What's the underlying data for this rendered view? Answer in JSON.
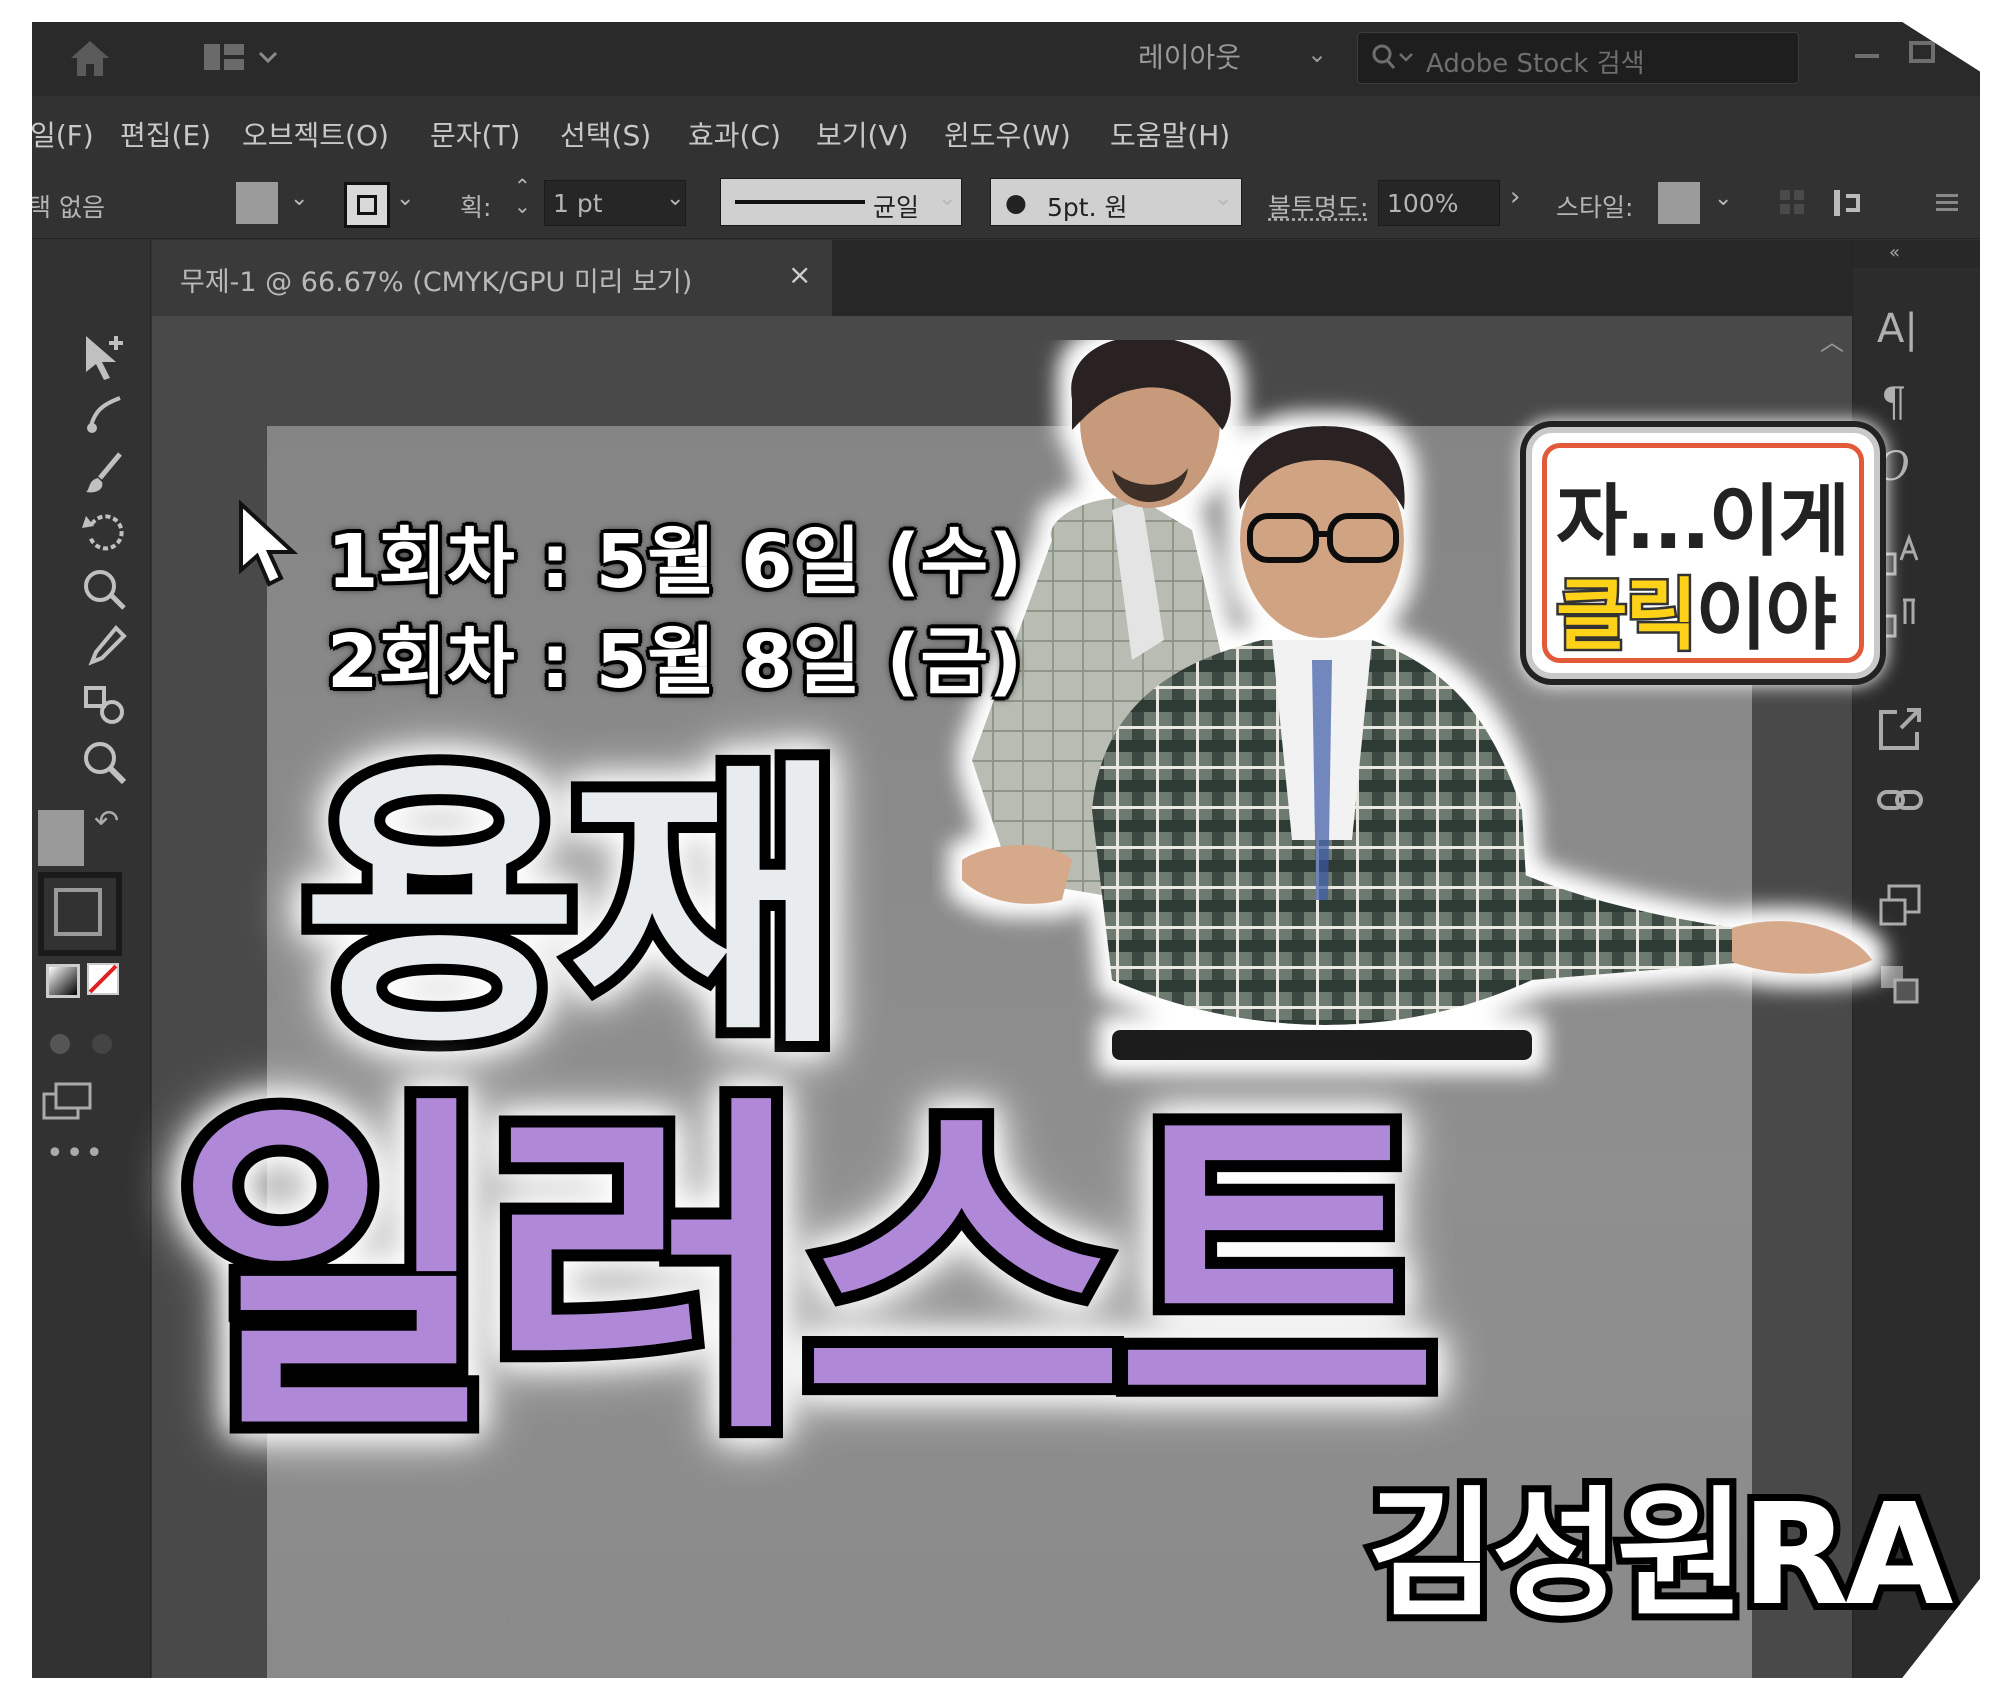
{
  "app": {
    "layout_label": "레이아웃",
    "stock_search_placeholder": "Adobe Stock 검색"
  },
  "menu": [
    "일(F)",
    "편집(E)",
    "오브젝트(O)",
    "문자(T)",
    "선택(S)",
    "효과(C)",
    "보기(V)",
    "윈도우(W)",
    "도움말(H)"
  ],
  "control_bar": {
    "selection_status": "택 없음",
    "stroke_label": "획:",
    "stroke_weight": "1 pt",
    "stroke_profile": "균일",
    "brush": "5pt. 원",
    "opacity_label": "불투명도:",
    "opacity_value": "100%",
    "style_label": "스타일:"
  },
  "document_tab": {
    "title": "무제-1 @ 66.67% (CMYK/GPU 미리 보기)",
    "close": "×"
  },
  "thumbnail": {
    "schedule": [
      "1회차 : 5월 6일 (수)",
      "2회차 : 5월 8일 (금)"
    ],
    "title_line1": "용재",
    "title_line2": "일러스트",
    "presenter": "김성원RA",
    "speech_line1": "자...이게",
    "speech_highlight": "클릭",
    "speech_rest": "이야"
  },
  "right_panel_icons": [
    "A|",
    "¶",
    "O"
  ],
  "colors": {
    "ui_dark": "#323232",
    "artboard": "#8a8a8a",
    "badge_border": "#e25a3a",
    "highlight": "#ffd21a"
  }
}
